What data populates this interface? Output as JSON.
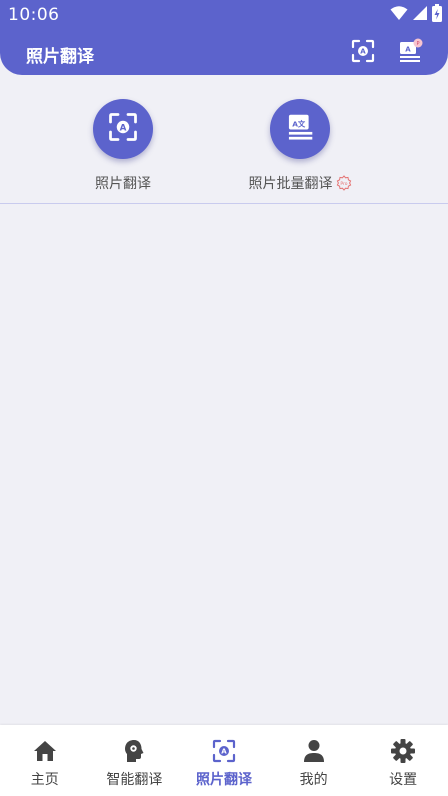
{
  "status_bar": {
    "time": "10:06",
    "icons": [
      "wifi-icon",
      "signal-icon",
      "battery-charging-icon"
    ]
  },
  "header": {
    "title": "照片翻译",
    "actions": [
      "scan-translate-icon",
      "batch-translate-icon"
    ]
  },
  "features": [
    {
      "label": "照片翻译",
      "icon": "scan-translate-icon"
    },
    {
      "label": "照片批量翻译",
      "icon": "batch-translate-icon",
      "badge": "Pro"
    }
  ],
  "bottom_nav": {
    "items": [
      {
        "label": "主页",
        "icon": "home-icon"
      },
      {
        "label": "智能翻译",
        "icon": "ai-head-icon"
      },
      {
        "label": "照片翻译",
        "icon": "scan-translate-icon",
        "active": true
      },
      {
        "label": "我的",
        "icon": "person-icon"
      },
      {
        "label": "设置",
        "icon": "gear-icon"
      }
    ]
  },
  "colors": {
    "primary": "#5c63cc",
    "background": "#f0f0f6",
    "nav_background": "#ffffff",
    "pro_badge": "#e57373"
  }
}
